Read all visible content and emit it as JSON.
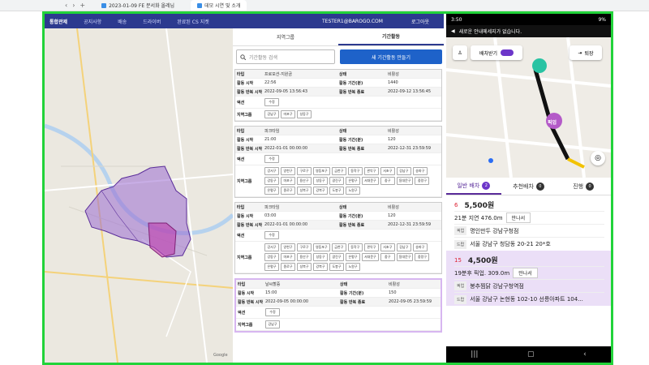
{
  "browser": {
    "tabs": [
      {
        "label": "2023-01-09 FE 분서화 올레님"
      },
      {
        "label": "데모 시연 및 소개"
      }
    ]
  },
  "nav": {
    "items": [
      "통합관제",
      "공지사항",
      "배송",
      "드라이버",
      "완료된 CS 지켓"
    ],
    "email": "TESTER1@BAROGO.COM",
    "logout": "로그아웃"
  },
  "map": {
    "credit": "Google"
  },
  "panel": {
    "tabs": [
      "지역그룹",
      "기간활동"
    ],
    "search_placeholder": "기간활동 검색",
    "new_button": "새 기간활동 만들기",
    "labels": {
      "type": "타입",
      "status": "상태",
      "start": "활동 시작",
      "period": "활동 기간(분)",
      "repeat_start": "활동 반복 시작",
      "repeat_end": "활동 반복 종료",
      "action": "액션",
      "group": "지역그룹"
    },
    "cards": [
      {
        "type": "프로모션-지원금",
        "status": "비활성",
        "start": "22:56",
        "period": "1440",
        "repeat_start": "2022-09-05 13:56:43",
        "repeat_end": "2022-09-12 13:56:45",
        "actions": [
          "수정"
        ],
        "groups": [
          "강남구",
          "마포구",
          "성동구"
        ]
      },
      {
        "type": "피크타임",
        "status": "비활성",
        "start": "21:00",
        "period": "120",
        "repeat_start": "2022-01-01 00:00:00",
        "repeat_end": "2022-12-31 23:59:59",
        "actions": [
          "수정"
        ],
        "groups": [
          "강서구",
          "양천구",
          "구로구",
          "영등포구",
          "금천구",
          "동작구",
          "관악구",
          "서초구",
          "강남구",
          "송파구",
          "강동구",
          "마포구",
          "용산구",
          "성동구",
          "광진구",
          "은평구",
          "서대문구",
          "중구",
          "동대문구",
          "중랑구",
          "은평구",
          "종로구",
          "성북구",
          "강북구",
          "도봉구",
          "노원구"
        ]
      },
      {
        "type": "피크타임",
        "status": "비활성",
        "start": "03:00",
        "period": "120",
        "repeat_start": "2022-01-01 00:00:00",
        "repeat_end": "2022-12-31 23:59:59",
        "actions": [
          "수정"
        ],
        "groups": [
          "강서구",
          "양천구",
          "구로구",
          "영등포구",
          "금천구",
          "동작구",
          "관악구",
          "서초구",
          "강남구",
          "송파구",
          "강동구",
          "마포구",
          "용산구",
          "성동구",
          "광진구",
          "은평구",
          "서대문구",
          "중구",
          "동대문구",
          "중랑구",
          "은평구",
          "종로구",
          "성북구",
          "강북구",
          "도봉구",
          "노원구"
        ]
      },
      {
        "type": "날씨할증",
        "status": "비활성",
        "start": "15:00",
        "period": "150",
        "repeat_start": "2022-09-05 00:00:00",
        "repeat_end": "2022-09-05 23:59:59",
        "actions": [
          "수정"
        ],
        "groups": [
          "강남구"
        ]
      }
    ]
  },
  "phone": {
    "time": "3:50",
    "battery": "9%",
    "notice": "새로운 안내메세지가 없습니다.",
    "dispatch_label": "배차받기",
    "exit_label": "퇴장",
    "pickup_label": "픽업",
    "tabs": [
      {
        "label": "일반 배차",
        "count": "2"
      },
      {
        "label": "추천배차",
        "count": "0"
      },
      {
        "label": "진행",
        "count": "0"
      }
    ],
    "orders": [
      {
        "num": "6",
        "price": "5,500원",
        "info": "21분 지연 476.0m",
        "status": "만나서",
        "pickup_tag": "픽업",
        "pickup": "명인만두 강남구청점",
        "drop_tag": "드랍",
        "drop": "서울 강남구 청담동 20-21 20*호"
      },
      {
        "num": "15",
        "price": "4,500원",
        "info": "19분후 픽업. 309.0m",
        "status": "만나서",
        "pickup_tag": "픽업",
        "pickup": "봉추찜닭 강남구청역점",
        "drop_tag": "드랍",
        "drop": "서울 강남구 논현동 102-10 선릉아파트 104..."
      }
    ]
  },
  "colors": {
    "accent": "#2c3a8f",
    "primary_button": "#1e62c9",
    "frame": "#22d33a",
    "highlight": "#ebdff7"
  }
}
